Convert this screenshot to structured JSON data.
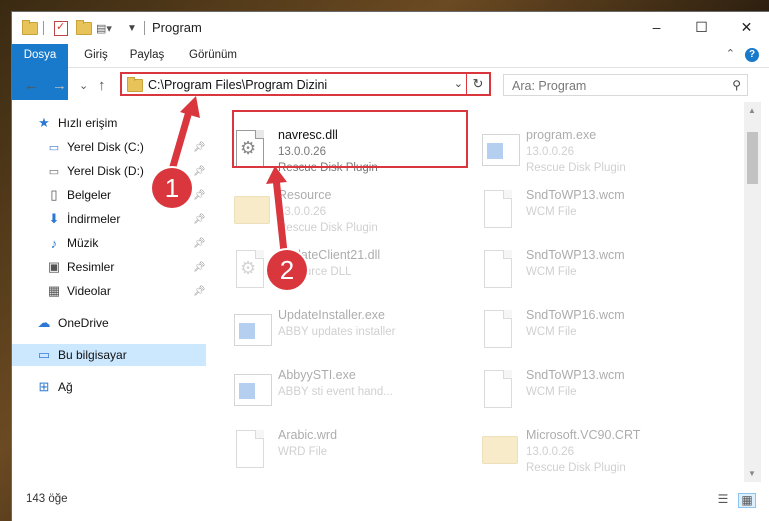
{
  "window": {
    "title": "Program",
    "controls": [
      "–",
      "☐",
      "✕"
    ]
  },
  "ribbon": {
    "tabs": [
      "Dosya",
      "Giriş",
      "Paylaş",
      "Görünüm"
    ],
    "help": "?",
    "collapse": "⌃"
  },
  "nav": {
    "back": "←",
    "forward": "→",
    "recent": "⌄",
    "up": "↑",
    "address": "C:\\Program Files\\Program Dizini",
    "address_dropdown": "⌄",
    "refresh": "↻",
    "search_placeholder": "Ara: Program",
    "search_icon": "⚲"
  },
  "sidebar": {
    "quick_access": "Hızlı erişim",
    "items": [
      {
        "label": "Yerel Disk (C:)",
        "icon": "drive-icon"
      },
      {
        "label": "Yerel Disk (D:)",
        "icon": "drive-icon"
      },
      {
        "label": "Belgeler",
        "icon": "documents-icon"
      },
      {
        "label": "İndirmeler",
        "icon": "download-icon"
      },
      {
        "label": "Müzik",
        "icon": "music-icon"
      },
      {
        "label": "Resimler",
        "icon": "pictures-icon"
      },
      {
        "label": "Videolar",
        "icon": "videos-icon"
      }
    ],
    "onedrive": "OneDrive",
    "this_pc": "Bu bilgisayar",
    "network": "Ağ"
  },
  "files": {
    "left": [
      {
        "name": "navresc.dll",
        "line2": "13.0.0.26",
        "line3": "Rescue Disk Plugin",
        "icon": "dll-icon"
      },
      {
        "name": "Resource",
        "line2": "13.0.0.26",
        "line3": "Rescue Disk Plugin",
        "icon": "folder-icon"
      },
      {
        "name": "UpdateClient21.dll",
        "line2": "Resource DLL",
        "line3": "",
        "icon": "dll-icon"
      },
      {
        "name": "UpdateInstaller.exe",
        "line2": "ABBY updates installer",
        "line3": "",
        "icon": "app-icon"
      },
      {
        "name": "AbbyySTI.exe",
        "line2": "ABBY sti event hand...",
        "line3": "",
        "icon": "app-icon"
      },
      {
        "name": "Arabic.wrd",
        "line2": "WRD File",
        "line3": "",
        "icon": "document-icon"
      }
    ],
    "right": [
      {
        "name": "program.exe",
        "line2": "13.0.0.26",
        "line3": "Rescue Disk Plugin",
        "icon": "app-icon"
      },
      {
        "name": "SndToWP13.wcm",
        "line2": "WCM File",
        "line3": "",
        "icon": "document-icon"
      },
      {
        "name": "SndToWP13.wcm",
        "line2": "WCM File",
        "line3": "",
        "icon": "document-icon"
      },
      {
        "name": "SndToWP16.wcm",
        "line2": "WCM File",
        "line3": "",
        "icon": "document-icon"
      },
      {
        "name": "SndToWP13.wcm",
        "line2": "WCM File",
        "line3": "",
        "icon": "document-icon"
      },
      {
        "name": "Microsoft.VC90.CRT",
        "line2": "13.0.0.26",
        "line3": "Rescue Disk Plugin",
        "icon": "folder-icon"
      }
    ]
  },
  "callouts": [
    "1",
    "2"
  ],
  "status": {
    "count": "143 öğe"
  },
  "colors": {
    "accent": "#1979ca",
    "highlight": "#d9363e",
    "selected": "#cce8ff"
  }
}
